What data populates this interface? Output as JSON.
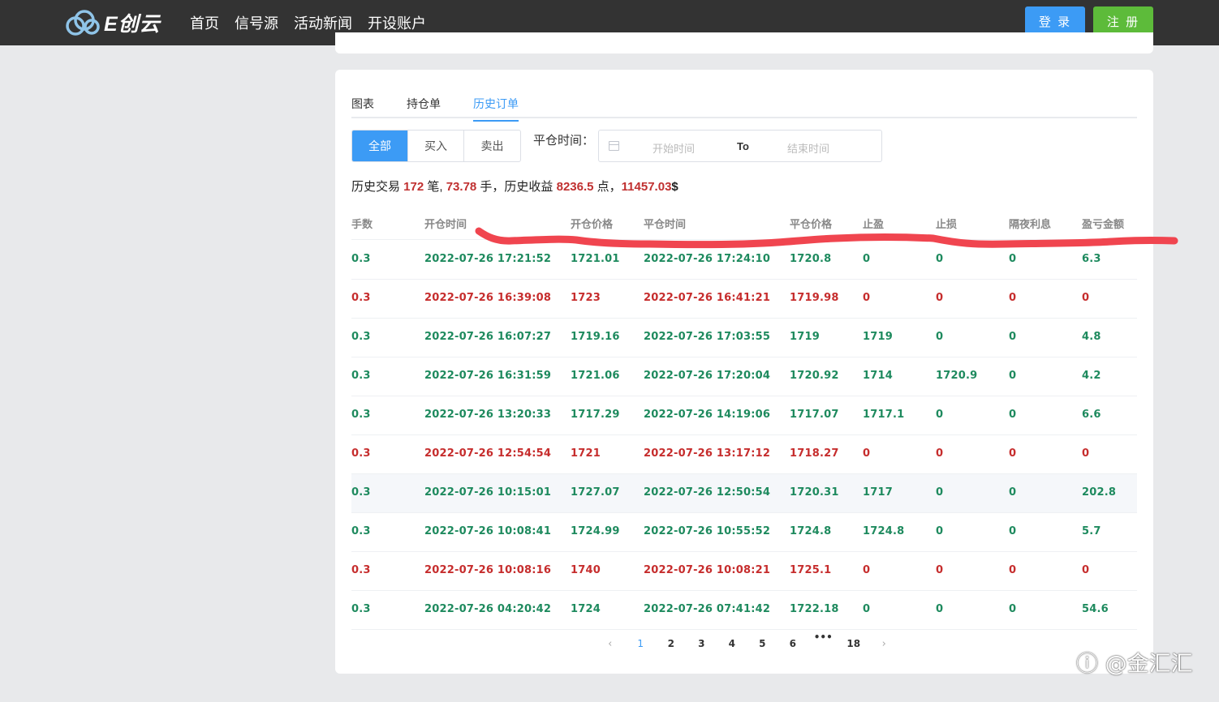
{
  "header": {
    "logo_text": "E创云",
    "nav": [
      "首页",
      "信号源",
      "活动新闻",
      "开设账户"
    ],
    "login_label": "登 录",
    "register_label": "注 册"
  },
  "tabs": [
    "图表",
    "持仓单",
    "历史订单"
  ],
  "active_tab": "历史订单",
  "filter": {
    "segments": [
      "全部",
      "买入",
      "卖出"
    ],
    "active_segment": "全部",
    "close_time_label": "平仓时间：",
    "start_placeholder": "开始时间",
    "to_label": "To",
    "end_placeholder": "结束时间"
  },
  "summary": {
    "prefix": "历史交易 ",
    "trades": "172",
    "trades_unit": " 笔, ",
    "lots": "73.78",
    "lots_unit": " 手，历史收益 ",
    "points": "8236.5",
    "points_unit": " 点，",
    "amount": "11457.03",
    "amount_unit": "$"
  },
  "table": {
    "headers": [
      "手数",
      "开仓时间",
      "开仓价格",
      "平仓时间",
      "平仓价格",
      "止盈",
      "止损",
      "隔夜利息",
      "盈亏金额"
    ],
    "rows": [
      {
        "status": "green",
        "cells": [
          "0.3",
          "2022-07-26 17:21:52",
          "1721.01",
          "2022-07-26 17:24:10",
          "1720.8",
          "0",
          "0",
          "0",
          "6.3"
        ]
      },
      {
        "status": "red",
        "cells": [
          "0.3",
          "2022-07-26 16:39:08",
          "1723",
          "2022-07-26 16:41:21",
          "1719.98",
          "0",
          "0",
          "0",
          "0"
        ]
      },
      {
        "status": "green",
        "cells": [
          "0.3",
          "2022-07-26 16:07:27",
          "1719.16",
          "2022-07-26 17:03:55",
          "1719",
          "1719",
          "0",
          "0",
          "4.8"
        ]
      },
      {
        "status": "green",
        "cells": [
          "0.3",
          "2022-07-26 16:31:59",
          "1721.06",
          "2022-07-26 17:20:04",
          "1720.92",
          "1714",
          "1720.9",
          "0",
          "4.2"
        ]
      },
      {
        "status": "green",
        "cells": [
          "0.3",
          "2022-07-26 13:20:33",
          "1717.29",
          "2022-07-26 14:19:06",
          "1717.07",
          "1717.1",
          "0",
          "0",
          "6.6"
        ]
      },
      {
        "status": "red",
        "cells": [
          "0.3",
          "2022-07-26 12:54:54",
          "1721",
          "2022-07-26 13:17:12",
          "1718.27",
          "0",
          "0",
          "0",
          "0"
        ]
      },
      {
        "status": "green",
        "cells": [
          "0.3",
          "2022-07-26 10:15:01",
          "1727.07",
          "2022-07-26 12:50:54",
          "1720.31",
          "1717",
          "0",
          "0",
          "202.8"
        ]
      },
      {
        "status": "green",
        "cells": [
          "0.3",
          "2022-07-26 10:08:41",
          "1724.99",
          "2022-07-26 10:55:52",
          "1724.8",
          "1724.8",
          "0",
          "0",
          "5.7"
        ]
      },
      {
        "status": "red",
        "cells": [
          "0.3",
          "2022-07-26 10:08:16",
          "1740",
          "2022-07-26 10:08:21",
          "1725.1",
          "0",
          "0",
          "0",
          "0"
        ]
      },
      {
        "status": "green",
        "cells": [
          "0.3",
          "2022-07-26 04:20:42",
          "1724",
          "2022-07-26 07:41:42",
          "1722.18",
          "0",
          "0",
          "0",
          "54.6"
        ]
      }
    ],
    "highlighted_row": 6
  },
  "pagination": {
    "prev": "‹",
    "pages": [
      "1",
      "2",
      "3",
      "4",
      "5",
      "6",
      "•••",
      "18"
    ],
    "current": "1",
    "next": "›"
  },
  "watermark": "@金汇汇",
  "colors": {
    "topbar": "#333333",
    "accent": "#3c9bf5",
    "register": "#5dbb3a",
    "profit_green": "#1e8a5e",
    "loss_red": "#c62d2d",
    "annotation_red": "#f0454f"
  }
}
